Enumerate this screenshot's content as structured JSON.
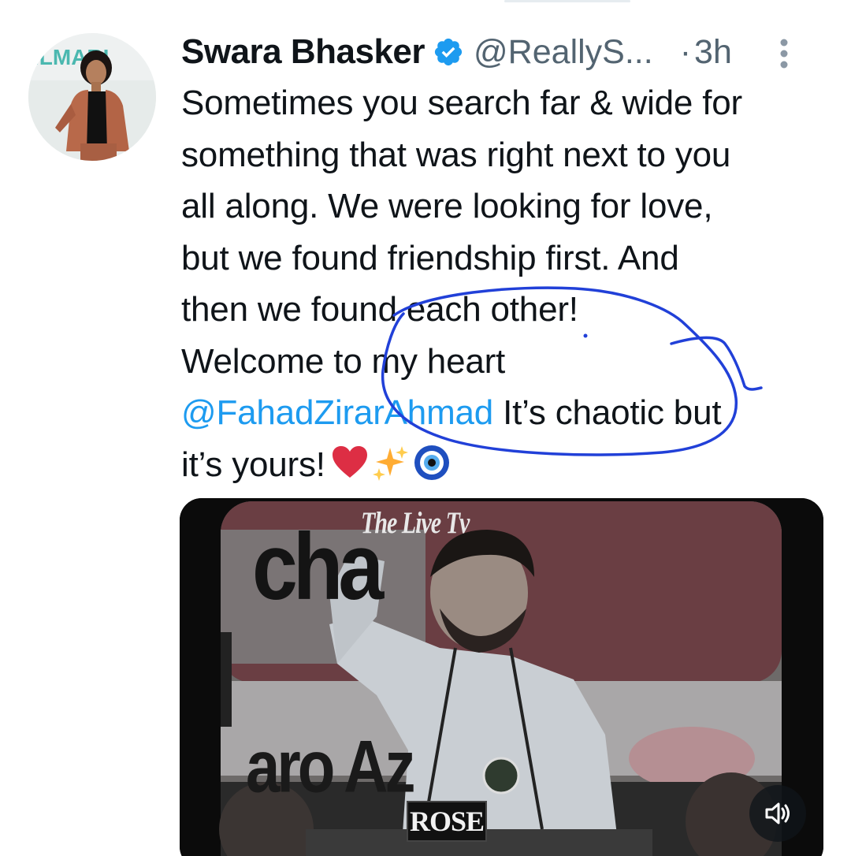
{
  "tweet": {
    "display_name": "Swara Bhasker",
    "handle": "@ReallyS...",
    "separator": "·",
    "time": "3h",
    "avatar_text": "ILMARI",
    "text_lines": [
      "Sometimes you search far & wide for",
      "something that was right next to you",
      "all along. We were looking for love,",
      "but we found friendship first. And",
      "then we found each other!",
      "Welcome to my heart"
    ],
    "mention": "@FahadZirarAhmad",
    "after_mention": " It’s chaotic but",
    "last_line": "it’s yours!",
    "emojis": [
      "heart-emoji",
      "sparkles-emoji",
      "nazar-emoji"
    ]
  },
  "media": {
    "sign_top": "cha",
    "channel_watermark": "The Live Tv",
    "sign_bottom": "aro Az",
    "podium_label": "ROSE",
    "sound_icon": "speaker-muted-icon"
  },
  "colors": {
    "text": "#0f1419",
    "secondary": "#536471",
    "link": "#1d9bf0",
    "verified": "#1d9bf0",
    "annotation_pen": "#2140d8"
  }
}
